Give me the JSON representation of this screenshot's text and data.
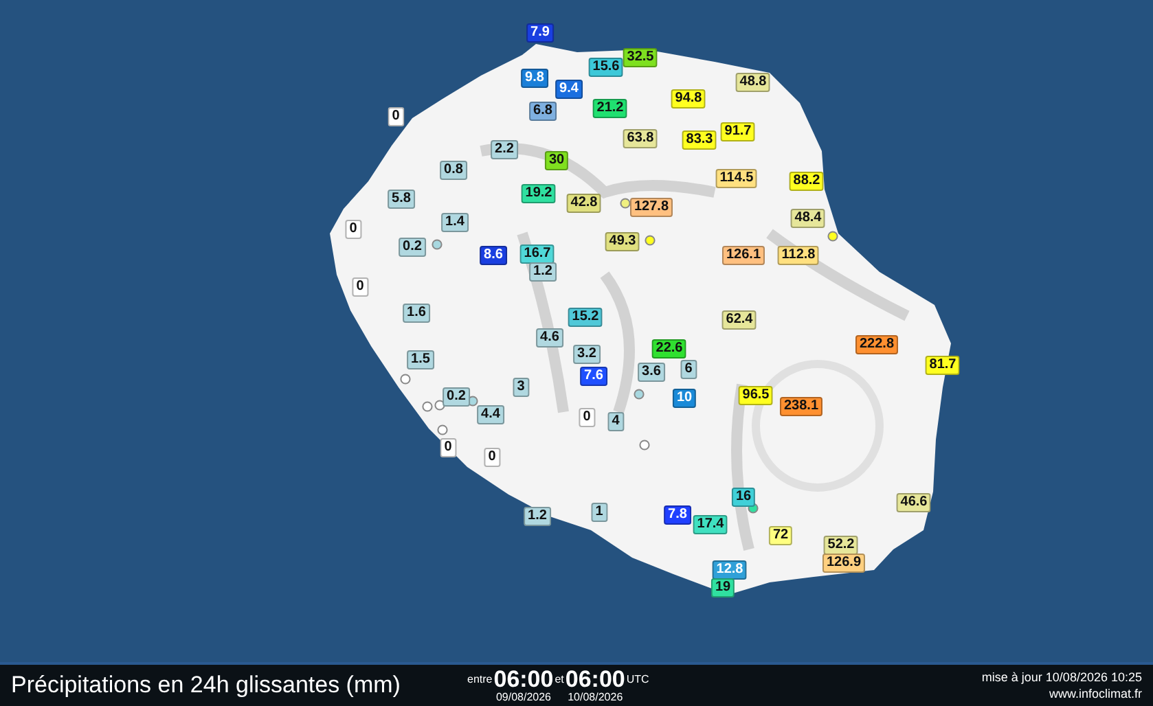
{
  "map": {
    "stations": [
      {
        "value": "7.9",
        "color": "#1a3fe0"
      },
      {
        "value": "9.8",
        "color": "#1a7fd8"
      },
      {
        "value": "9.4",
        "color": "#1a6fe0"
      },
      {
        "value": "15.6",
        "color": "#3cc8d8"
      },
      {
        "value": "32.5",
        "color": "#7ee020"
      },
      {
        "value": "48.8",
        "color": "#e6e69a"
      },
      {
        "value": "0",
        "color": "#ffffff"
      },
      {
        "value": "6.8",
        "color": "#7fb0e0"
      },
      {
        "value": "21.2",
        "color": "#20e070"
      },
      {
        "value": "94.8",
        "color": "#ffff20"
      },
      {
        "value": "63.8",
        "color": "#e6e69a"
      },
      {
        "value": "83.3",
        "color": "#ffff20"
      },
      {
        "value": "91.7",
        "color": "#ffff20"
      },
      {
        "value": "2.2",
        "color": "#b0d8e0"
      },
      {
        "value": "30",
        "color": "#80e020"
      },
      {
        "value": "114.5",
        "color": "#ffe080"
      },
      {
        "value": "0.8",
        "color": "#b0d8e0"
      },
      {
        "value": "88.2",
        "color": "#ffff20"
      },
      {
        "value": "5.8",
        "color": "#b0d8e0"
      },
      {
        "value": "19.2",
        "color": "#30e0a0"
      },
      {
        "value": "42.8",
        "color": "#e0e080"
      },
      {
        "value": "127.8",
        "color": "#ffc080"
      },
      {
        "value": "48.4",
        "color": "#e6e69a"
      },
      {
        "value": "0",
        "color": "#ffffff"
      },
      {
        "value": "1.4",
        "color": "#b0d8e0"
      },
      {
        "value": "0.2",
        "color": "#b0d8e0"
      },
      {
        "value": "8.6",
        "color": "#1a3fe0"
      },
      {
        "value": "16.7",
        "color": "#50d8d8"
      },
      {
        "value": "1.2",
        "color": "#b0d8e0"
      },
      {
        "value": "49.3",
        "color": "#e0e080"
      },
      {
        "value": "126.1",
        "color": "#ffc080"
      },
      {
        "value": "112.8",
        "color": "#ffe080"
      },
      {
        "value": "0",
        "color": "#ffffff"
      },
      {
        "value": "1.6",
        "color": "#b0d8e0"
      },
      {
        "value": "15.2",
        "color": "#50c8d8"
      },
      {
        "value": "62.4",
        "color": "#e6e69a"
      },
      {
        "value": "4.6",
        "color": "#b0d8e0"
      },
      {
        "value": "3.2",
        "color": "#b0d8e0"
      },
      {
        "value": "22.6",
        "color": "#30e030"
      },
      {
        "value": "6",
        "color": "#b0d8e0"
      },
      {
        "value": "222.8",
        "color": "#ff9030"
      },
      {
        "value": "1.5",
        "color": "#b0d8e0"
      },
      {
        "value": "7.6",
        "color": "#2050ff"
      },
      {
        "value": "3.6",
        "color": "#b0d8e0"
      },
      {
        "value": "81.7",
        "color": "#ffff20"
      },
      {
        "value": "3",
        "color": "#b0d8e0"
      },
      {
        "value": "10",
        "color": "#1a8ad8"
      },
      {
        "value": "96.5",
        "color": "#ffff20"
      },
      {
        "value": "238.1",
        "color": "#ff9030"
      },
      {
        "value": "0.2",
        "color": "#b0d8e0"
      },
      {
        "value": "4.4",
        "color": "#b0d8e0"
      },
      {
        "value": "0",
        "color": "#ffffff"
      },
      {
        "value": "4",
        "color": "#b0d8e0"
      },
      {
        "value": "0",
        "color": "#ffffff"
      },
      {
        "value": "0",
        "color": "#ffffff"
      },
      {
        "value": "16",
        "color": "#40d0d8"
      },
      {
        "value": "46.6",
        "color": "#e6e69a"
      },
      {
        "value": "1.2",
        "color": "#b0d8e0"
      },
      {
        "value": "1",
        "color": "#b0d8e0"
      },
      {
        "value": "7.8",
        "color": "#2040ff"
      },
      {
        "value": "17.4",
        "color": "#40e0c0"
      },
      {
        "value": "72",
        "color": "#ffff80"
      },
      {
        "value": "52.2",
        "color": "#e6e69a"
      },
      {
        "value": "126.9",
        "color": "#ffd080"
      },
      {
        "value": "12.8",
        "color": "#30a0d8"
      },
      {
        "value": "19",
        "color": "#30e0a0"
      }
    ]
  },
  "footer": {
    "title": "Précipitations en 24h glissantes (mm)",
    "between": "entre",
    "start_time": "06:00",
    "and": "et",
    "end_time": "06:00",
    "timezone": "UTC",
    "start_date": "09/08/2026",
    "end_date": "10/08/2026",
    "updated": "mise à jour 10/08/2026 10:25",
    "site": "www.infoclimat.fr"
  }
}
